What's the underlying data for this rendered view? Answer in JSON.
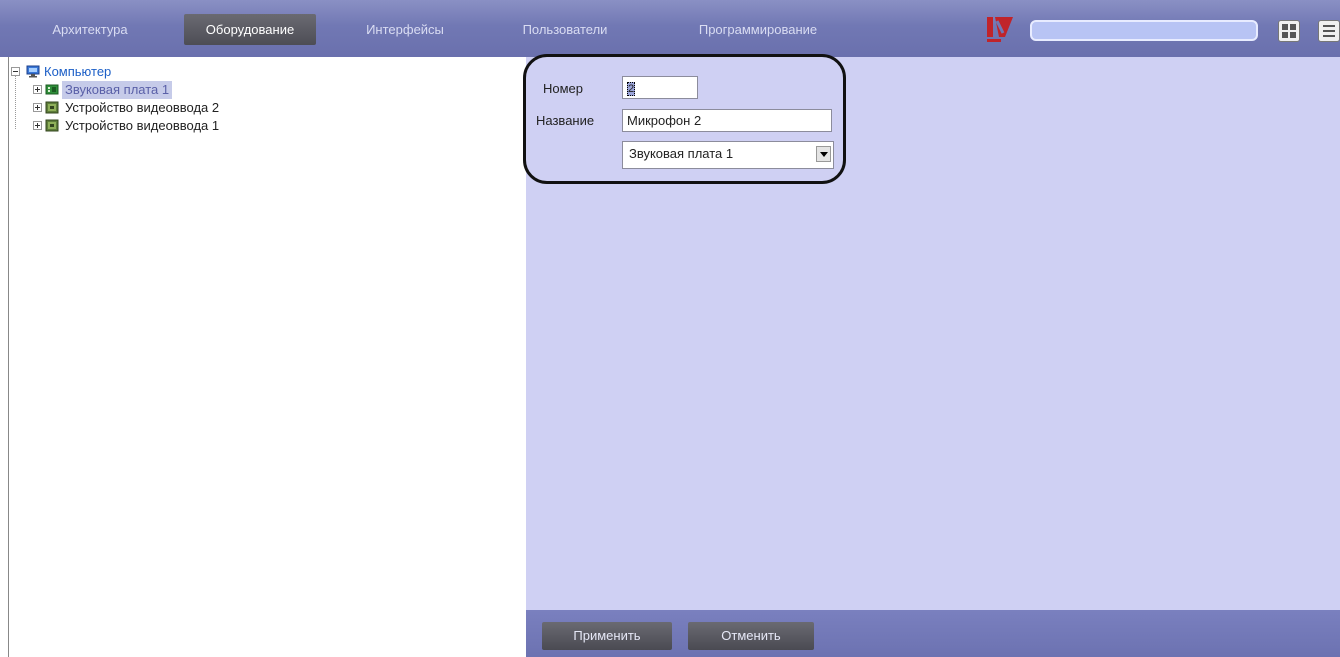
{
  "tabs": [
    {
      "label": "Архитектура"
    },
    {
      "label": "Оборудование"
    },
    {
      "label": "Интерфейсы"
    },
    {
      "label": "Пользователи"
    },
    {
      "label": "Программирование"
    }
  ],
  "active_tab": "Оборудование",
  "search": {
    "value": ""
  },
  "tree": {
    "root": {
      "label": "Компьютер",
      "icon": "computer-icon"
    },
    "items": [
      {
        "label": "Звуковая плата 1",
        "icon": "sound-card-icon",
        "selected": true
      },
      {
        "label": "Устройство видеоввода 2",
        "icon": "video-capture-icon",
        "selected": false
      },
      {
        "label": "Устройство видеоввода 1",
        "icon": "video-capture-icon",
        "selected": false
      }
    ]
  },
  "form": {
    "number_label": "Номер",
    "number_value": "2",
    "name_label": "Название",
    "name_value": "Микрофон 2",
    "device_value": "Звуковая плата 1"
  },
  "buttons": {
    "apply": "Применить",
    "cancel": "Отменить"
  },
  "colors": {
    "topbar": "#7178b4",
    "panel": "#cfd0f3",
    "active_tab": "#55555d",
    "search": "#b8c4f4"
  }
}
